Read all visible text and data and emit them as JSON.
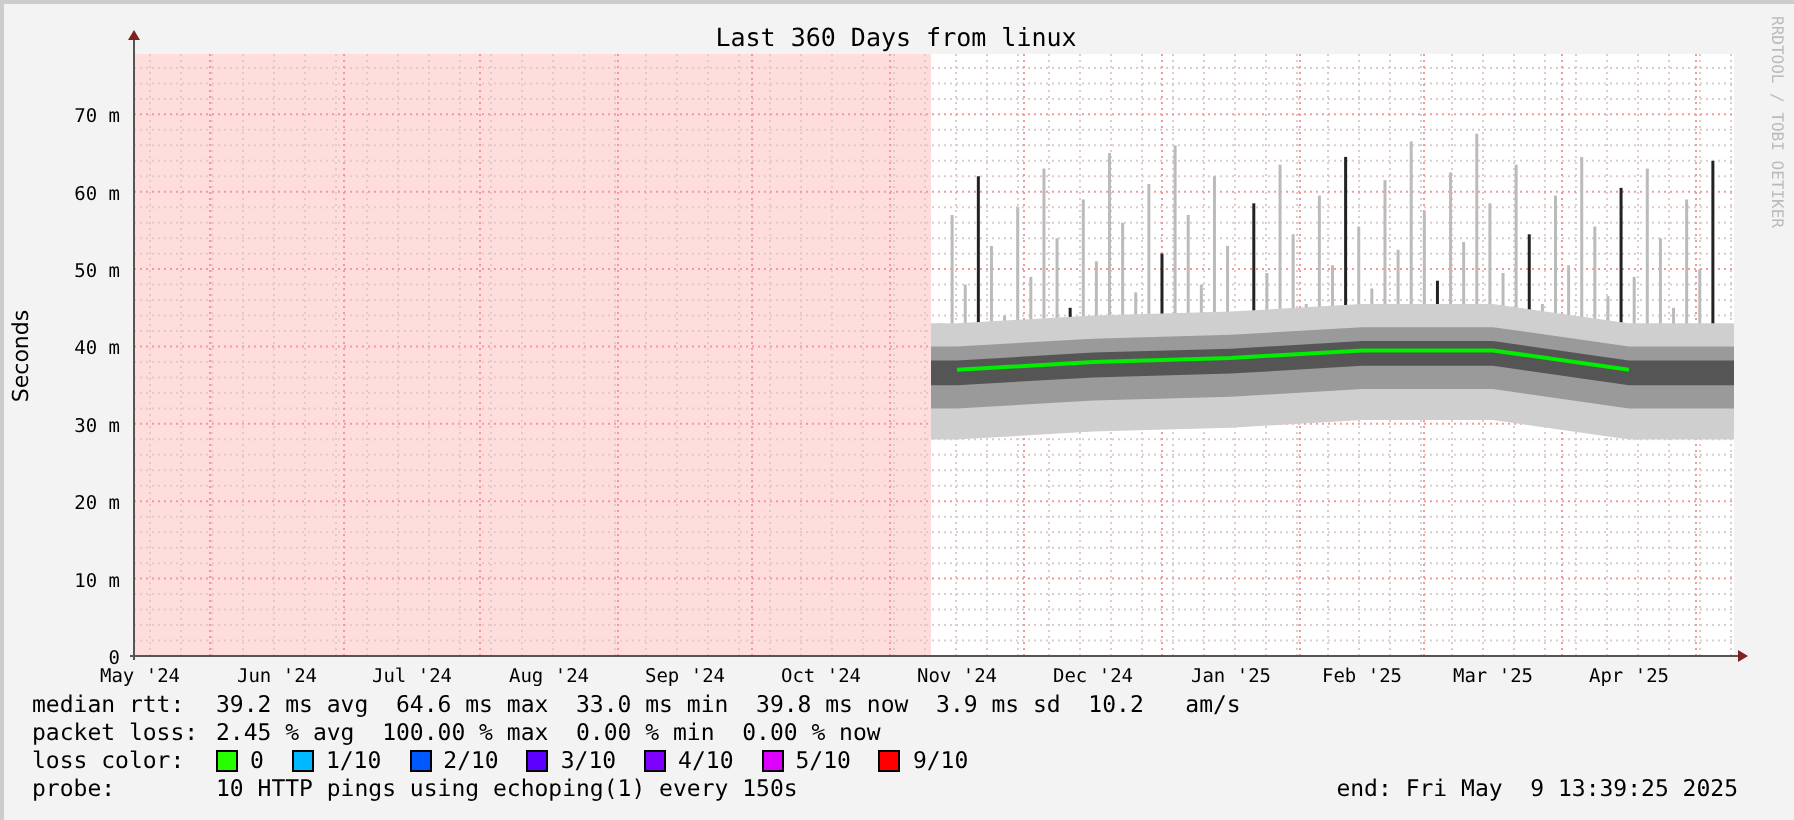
{
  "chart": {
    "chart_data": {
      "type": "line",
      "title": "Last 360 Days from linux",
      "ylabel": "Seconds",
      "categories": [
        "May '24",
        "Jun '24",
        "Jul '24",
        "Aug '24",
        "Sep '24",
        "Oct '24",
        "Nov '24",
        "Dec '24",
        "Jan '25",
        "Feb '25",
        "Mar '25",
        "Apr '25"
      ],
      "grid": true,
      "series": [
        {
          "name": "median rtt:",
          "color": "#00ee00",
          "values": [
            null,
            null,
            null,
            null,
            null,
            null,
            37,
            38,
            38.5,
            39.5,
            39.5,
            37
          ]
        }
      ],
      "ylim": [
        0,
        77.8
      ],
      "yticks": [
        0,
        {
          "value": 10,
          "label": "10 m"
        },
        {
          "value": 20,
          "label": "20 m"
        },
        {
          "value": 30,
          "label": "30 m"
        },
        {
          "value": 40,
          "label": "40 m"
        },
        {
          "value": 50,
          "label": "50 m"
        },
        {
          "value": 60,
          "label": "60 m"
        },
        {
          "value": 70,
          "label": "70 m"
        }
      ]
    },
    "credit": "RRDTOOL / TOBI OETIKER"
  },
  "legend": {
    "stats": [
      {
        "text": "39.2 ms avg  64.6 ms max  33.0 ms min  39.8 ms now  3.9 ms sd  10.2   am/s"
      },
      {
        "label": "packet loss:",
        "text": "2.45 % avg  100.00 % max  0.00 % min  0.00 % now"
      }
    ],
    "loss_label": "loss color:",
    "loss_colors": [
      {
        "label": "0",
        "color": "#26ff00"
      },
      {
        "label": "1/10",
        "color": "#00b8ff"
      },
      {
        "label": "2/10",
        "color": "#0059ff"
      },
      {
        "label": "3/10",
        "color": "#5e00ff"
      },
      {
        "label": "4/10",
        "color": "#7e00ff"
      },
      {
        "label": "5/10",
        "color": "#dd00ff"
      },
      {
        "label": "9/10",
        "color": "#ff0000"
      }
    ],
    "probe_label": "probe:",
    "probe": "10 HTTP pings using echoping(1) every 150s",
    "end": "end: Fri May  9 13:39:25 2025"
  }
}
